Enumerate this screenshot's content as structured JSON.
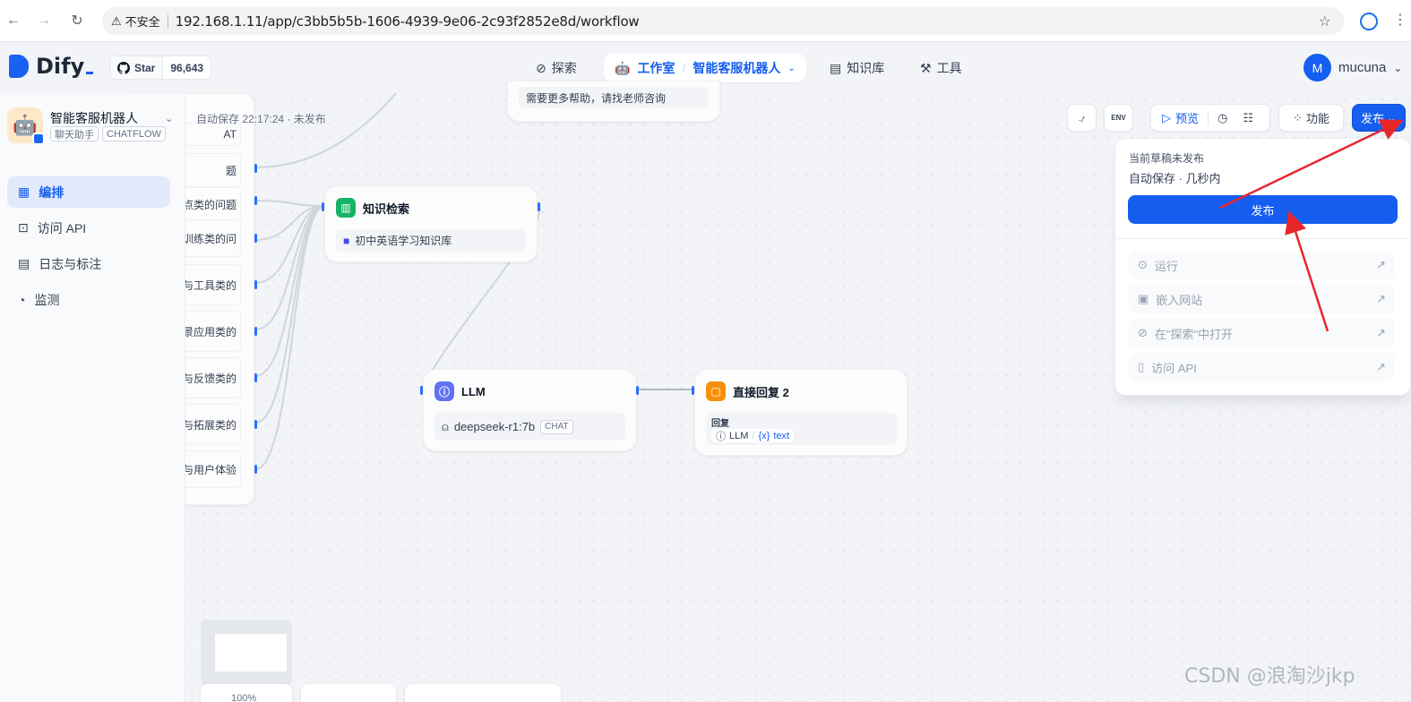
{
  "browser": {
    "insecure_label": "不安全",
    "url": "192.168.1.11/app/c3bb5b5b-1606-4939-9e06-2c93f2852e8d/workflow"
  },
  "header": {
    "logo_text": "Dify",
    "github_star_label": "Star",
    "github_star_count": "96,643",
    "nav": {
      "explore": "探索",
      "studio": "工作室",
      "app_name": "智能客服机器人",
      "knowledge": "知识库",
      "tools": "工具"
    },
    "user_initial": "M",
    "user_name": "mucuna"
  },
  "sidebar": {
    "app_name": "智能客服机器人",
    "tags": [
      "聊天助手",
      "CHATFLOW"
    ],
    "items": [
      {
        "label": "编排",
        "icon": "layout-icon",
        "active": true
      },
      {
        "label": "访问 API",
        "icon": "terminal-icon",
        "active": false
      },
      {
        "label": "日志与标注",
        "icon": "file-list-icon",
        "active": false
      },
      {
        "label": "监测",
        "icon": "dashboard-icon",
        "active": false
      }
    ]
  },
  "canvas": {
    "autosave_status": "自动保存 22:17:24 · 未发布",
    "top_note": "需要更多帮助，请找老师咨询",
    "classifier_rows": [
      "AT",
      "题",
      "点类的问题",
      "训练类的问",
      "与工具类的",
      "景应用类的",
      "与反馈类的",
      "与拓展类的",
      "与用户体验"
    ],
    "knowledge_node": {
      "title": "知识检索",
      "dataset": "初中英语学习知识库"
    },
    "llm_node": {
      "title": "LLM",
      "model": "deepseek-r1:7b",
      "model_tag": "CHAT"
    },
    "answer_node": {
      "title": "直接回复 2",
      "field_label": "回复",
      "var_source": "LLM",
      "var_name": "text",
      "var_prefix": "{x}"
    }
  },
  "toolbar": {
    "env_label": "ENV",
    "preview_label": "预览",
    "features_label": "功能",
    "publish_label": "发布"
  },
  "publish_panel": {
    "status": "当前草稿未发布",
    "autosave": "自动保存 · 几秒内",
    "publish_button": "发布",
    "items": [
      "运行",
      "嵌入网站",
      "在\"探索\"中打开",
      "访问 API"
    ]
  },
  "zoom_label": "100%",
  "watermark": "CSDN @浪淘沙jkp",
  "colors": {
    "primary": "#155eef",
    "annotation": "#e8262a"
  }
}
